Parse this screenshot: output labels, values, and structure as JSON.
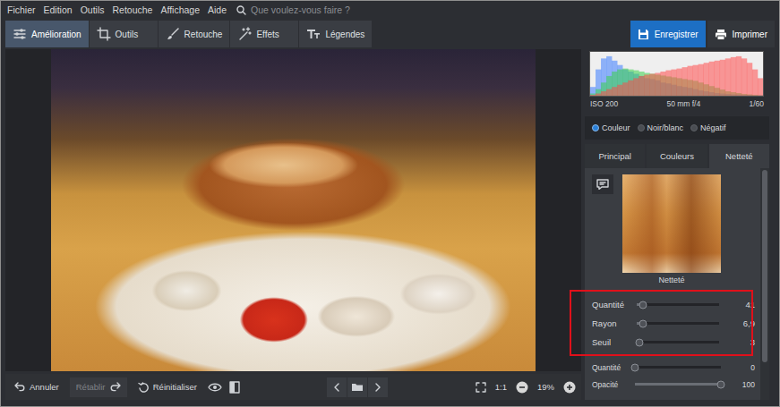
{
  "menu": [
    "Fichier",
    "Edition",
    "Outils",
    "Retouche",
    "Affichage",
    "Aide"
  ],
  "search": {
    "placeholder": "Que voulez-vous faire ?"
  },
  "tabs": [
    {
      "label": "Amélioration",
      "selected": true
    },
    {
      "label": "Outils",
      "selected": false
    },
    {
      "label": "Retouche",
      "selected": false
    },
    {
      "label": "Effets",
      "selected": false
    },
    {
      "label": "Légendes",
      "selected": false
    }
  ],
  "actions": [
    {
      "label": "Enregistrer",
      "kind": "primary"
    },
    {
      "label": "Imprimer",
      "kind": "secondary"
    }
  ],
  "histogram": {
    "series": [
      {
        "color": "#3a7bff",
        "values": [
          20,
          60,
          85,
          90,
          80,
          70,
          60,
          55,
          50,
          45,
          40,
          38,
          35,
          30,
          28,
          25,
          22,
          20,
          18,
          15,
          12,
          10,
          8,
          6,
          5,
          4,
          3,
          3,
          2,
          2,
          1,
          1
        ]
      },
      {
        "color": "#3ad24a",
        "values": [
          5,
          15,
          30,
          45,
          55,
          60,
          62,
          60,
          58,
          55,
          52,
          50,
          48,
          46,
          44,
          42,
          40,
          38,
          36,
          34,
          30,
          26,
          22,
          18,
          14,
          10,
          8,
          6,
          4,
          3,
          2,
          1
        ]
      },
      {
        "color": "#ff4a4a",
        "values": [
          2,
          5,
          10,
          15,
          20,
          25,
          30,
          35,
          40,
          45,
          48,
          50,
          52,
          55,
          58,
          60,
          62,
          65,
          68,
          70,
          72,
          75,
          78,
          80,
          82,
          85,
          88,
          90,
          85,
          75,
          60,
          40
        ]
      }
    ]
  },
  "exif": [
    "ISO 200",
    "50 mm f/4",
    "1/60"
  ],
  "color_modes": [
    {
      "label": "Couleur",
      "selected": true
    },
    {
      "label": "Noir/blanc",
      "selected": false
    },
    {
      "label": "Négatif",
      "selected": false
    }
  ],
  "panel_tabs": [
    {
      "label": "Principal",
      "selected": false
    },
    {
      "label": "Couleurs",
      "selected": false
    },
    {
      "label": "Netteté",
      "selected": true
    }
  ],
  "preview": {
    "label": "Netteté"
  },
  "sharpen_sliders": [
    {
      "label": "Quantité",
      "value": "41",
      "level": 0.08
    },
    {
      "label": "Rayon",
      "value": "6,9",
      "level": 0.08
    },
    {
      "label": "Seuil",
      "value": "3",
      "level": 0.03
    }
  ],
  "extra_sliders": [
    {
      "label": "Quantité",
      "value": "0",
      "level": 0
    },
    {
      "label": "Opacité",
      "value": "100",
      "level": 1
    }
  ],
  "history": [
    {
      "label": "Annuler",
      "kind": "undo",
      "disabled": false
    },
    {
      "label": "Rétablir",
      "kind": "redo",
      "disabled": true
    }
  ],
  "reset": {
    "label": "Réinitialiser"
  },
  "zoom": {
    "actual_size": "1:1",
    "level": "19%"
  }
}
